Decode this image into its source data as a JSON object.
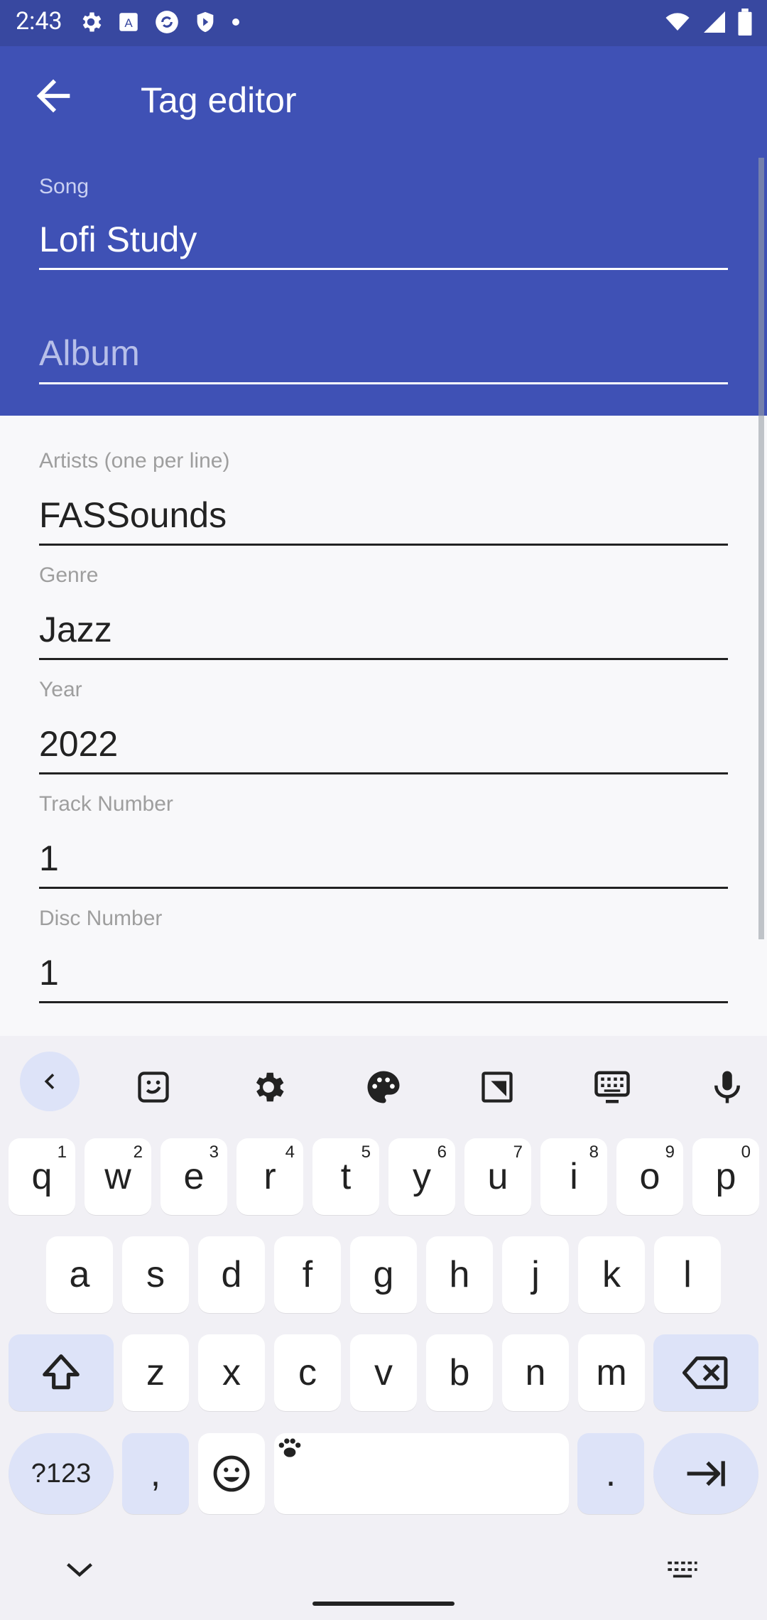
{
  "status": {
    "time": "2:43",
    "left_icons": [
      "settings-icon",
      "accessibility-icon",
      "sync-icon",
      "shield-icon",
      "dot-icon"
    ],
    "right_icons": [
      "wifi-icon",
      "signal-icon",
      "battery-icon"
    ]
  },
  "toolbar": {
    "title": "Tag editor",
    "back_icon": "arrow-back-icon"
  },
  "form": {
    "song": {
      "label": "Song",
      "value": "Lofi Study"
    },
    "album": {
      "placeholder": "Album"
    },
    "artists": {
      "label": "Artists (one per line)",
      "value": "FASSounds"
    },
    "genre": {
      "label": "Genre",
      "value": "Jazz"
    },
    "year": {
      "label": "Year",
      "value": "2022"
    },
    "track": {
      "label": "Track Number",
      "value": "1"
    },
    "disc": {
      "label": "Disc Number",
      "value": "1"
    }
  },
  "keyboard": {
    "toolbar_icons": [
      "chevron-left-icon",
      "sticker-icon",
      "settings-icon",
      "palette-icon",
      "resize-icon",
      "keyboard-icon",
      "mic-icon"
    ],
    "row1": [
      {
        "key": "q",
        "sup": "1"
      },
      {
        "key": "w",
        "sup": "2"
      },
      {
        "key": "e",
        "sup": "3"
      },
      {
        "key": "r",
        "sup": "4"
      },
      {
        "key": "t",
        "sup": "5"
      },
      {
        "key": "y",
        "sup": "6"
      },
      {
        "key": "u",
        "sup": "7"
      },
      {
        "key": "i",
        "sup": "8"
      },
      {
        "key": "o",
        "sup": "9"
      },
      {
        "key": "p",
        "sup": "0"
      }
    ],
    "row2": [
      "a",
      "s",
      "d",
      "f",
      "g",
      "h",
      "j",
      "k",
      "l"
    ],
    "row3": [
      "z",
      "x",
      "c",
      "v",
      "b",
      "n",
      "m"
    ],
    "symbols_label": "?123",
    "comma_label": ",",
    "period_label": ".",
    "shift_icon": "shift-icon",
    "backspace_icon": "backspace-icon",
    "emoji_icon": "emoji-icon",
    "enter_icon": "tab-next-icon",
    "space_icon": "paw-icon"
  },
  "nav": {
    "back_icon": "chevron-down-icon",
    "keyboard_icon": "keyboard-switch-icon"
  },
  "colors": {
    "primary": "#3f51b5",
    "status": "#3848a0",
    "accent_key": "#dde3f8",
    "text_dark": "#222222"
  }
}
